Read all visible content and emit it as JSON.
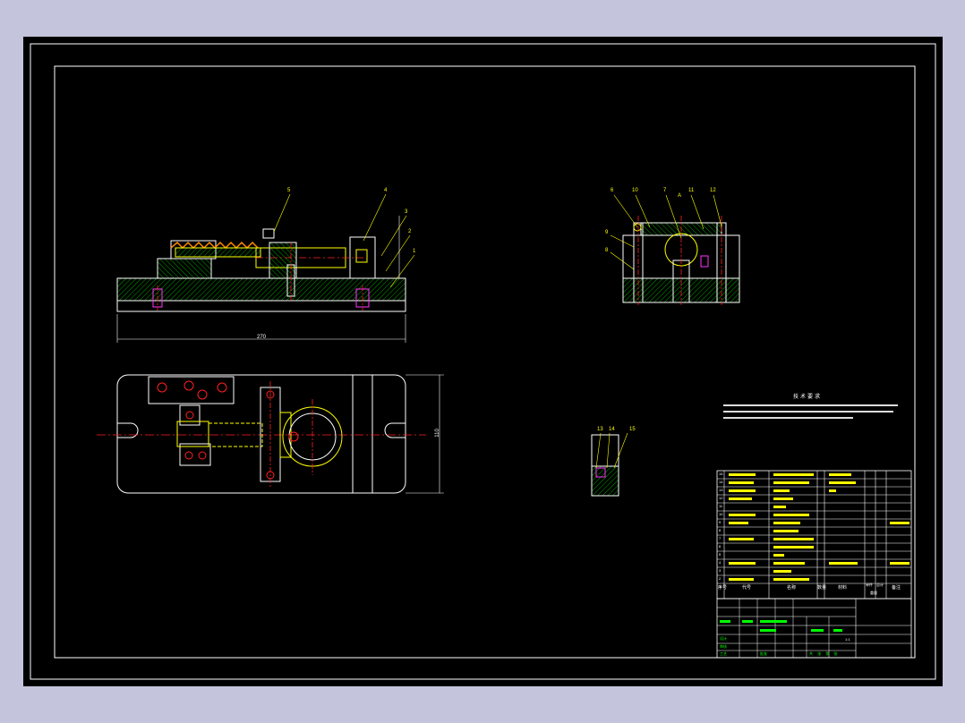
{
  "drawing": {
    "front_view": {
      "balloons": [
        "5",
        "4",
        "3",
        "2",
        "1"
      ],
      "overall_dim": "270"
    },
    "side_view": {
      "balloons": [
        "6",
        "10",
        "7",
        "11",
        "12",
        "9",
        "8"
      ],
      "section_mark": "A"
    },
    "plan_view": {
      "width_dim": "110"
    },
    "detail_view": {
      "balloons": [
        "13",
        "14",
        "15"
      ]
    },
    "tech_requirements": {
      "title": "技术要求"
    },
    "parts_list": {
      "index_numbers": [
        "15",
        "14",
        "13",
        "12",
        "11",
        "10",
        "9",
        "8",
        "7",
        "6",
        "5",
        "4",
        "3",
        "2",
        "1"
      ],
      "header": {
        "index": "序号",
        "code": "代号",
        "name": "名称",
        "qty": "数量",
        "material": "材料",
        "unit_weight": "单件",
        "total_weight": "总计",
        "weight": "重量",
        "remarks": "备注"
      }
    },
    "title_block": {
      "designer": "设计",
      "reviewer": "审核",
      "process": "工艺",
      "approve": "批准",
      "scale_ratio": "1:1",
      "sheets": "共 张 第 张"
    }
  },
  "colors": {
    "background": "#c4c4dc",
    "sheet": "#000000",
    "outline": "#ffffff",
    "dimension": "#ffff00",
    "centerline": "#ff2020",
    "hatch": "#00ff00",
    "hidden": "#ffff00",
    "text": "#ffff00"
  }
}
